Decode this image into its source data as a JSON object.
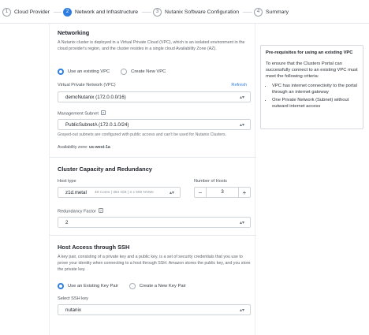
{
  "stepper": {
    "steps": [
      {
        "num": "1",
        "label": "Cloud Provider"
      },
      {
        "num": "2",
        "label": "Network and Infrastructure"
      },
      {
        "num": "3",
        "label": "Nutanix Software Configuration"
      },
      {
        "num": "4",
        "label": "Summary"
      }
    ]
  },
  "networking": {
    "title": "Networking",
    "description": "A Nutanix cluster is deployed in a Virtual Private Cloud (VPC), which is an isolated environment in the cloud provider's region, and the cluster resides in a single cloud Availability Zone (AZ).",
    "vpc_options": [
      "Use an existing VPC",
      "Create New VPC"
    ],
    "vpc_label": "Virtual Private Network (VPC)",
    "refresh": "Refresh",
    "vpc_value": "demoNutanix (172.0.0.0/16)",
    "subnet_label": "Management Subnet",
    "subnet_value": "PublicSubnetA (172.0.1.0/24)",
    "subnet_note": "Grayed-out subnets are configured with public access and can't be used for Nutanix Clusters.",
    "az_label": "Availability zone:",
    "az_value": "us-west-1a"
  },
  "capacity": {
    "title": "Cluster Capacity and Redundancy",
    "host_type_label": "Host type",
    "host_type_value": "z1d.metal",
    "host_type_extra": "48 Cores  |  384 GiB  |  2 x 900 NVMe",
    "hosts_label": "Number of Hosts",
    "hosts_value": "3",
    "redundancy_label": "Redundancy Factor",
    "redundancy_value": "2"
  },
  "ssh": {
    "title": "Host Access through SSH",
    "description": "A key pair, consisting of a private key and a public key, is a set of security credentials that you use to prove your identity when connecting to a host through SSH. Amazon stores the public key, and you store the private key.",
    "options": [
      "Use an Existing Key Pair",
      "Create a New Key Pair"
    ],
    "key_label": "Select SSH key",
    "key_value": "nutanix"
  },
  "panel": {
    "title": "Pre-requisites for using an existing VPC",
    "text": "To ensure that the Clusters Portal can successfully connect to an existing VPC must meet the following criteria:",
    "items": [
      "VPC has internet connectivity to the portal through an internet gateway",
      "One Private Network (Subnet) without outward internet access"
    ]
  },
  "colors": {
    "accent": "#2e7de1",
    "border": "#cfd4d9",
    "text": "#22272e"
  }
}
